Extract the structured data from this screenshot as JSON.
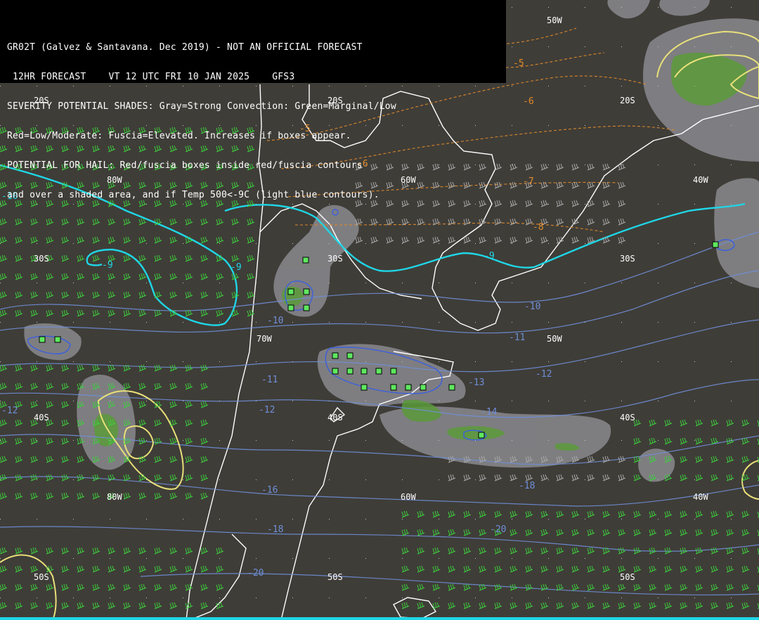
{
  "header": {
    "lines": [
      "GR02T (Galvez & Santavana. Dec 2019) - NOT AN OFFICIAL FORECAST",
      " 12HR FORECAST    VT 12 UTC FRI 10 JAN 2025    GFS3",
      "SEVERITY POTENTIAL SHADES: Gray=Strong Convection: Green=Marginal/Low",
      "Red=Low/Moderate: Fuscia=Elevated. Increases if boxes appear.",
      "POTENTIAL FOR HAIL: Red/fuscia boxes inside red/fuscia contours",
      "and over a shaded area, and if Temp 500<-9C (light blue contours)."
    ]
  },
  "colors": {
    "background": "#3f3d38",
    "land_outline": "#ffffff",
    "severity_gray": "#8a8a8e",
    "severity_green": "#5a9a3a",
    "temp_minus9": "#1fd6e6",
    "temp_contour": "#6f8fd8",
    "thickness_contour": "#d9862a",
    "jet_contour": "#e9e07a",
    "wind_barb_green": "#3ccf3c",
    "wind_barb_gray": "#a8a8a8",
    "hail_box": "#5fe85f"
  },
  "grid": {
    "lat_labels": [
      "20S",
      "30S",
      "40S",
      "50S"
    ],
    "lon_labels": [
      "80W",
      "70W",
      "60W",
      "50W",
      "40W"
    ]
  },
  "temp_labels": [
    "-9",
    "-9",
    "-9",
    "-10",
    "-10",
    "-11",
    "-11",
    "-12",
    "-12",
    "-13",
    "-14",
    "-16",
    "-18",
    "-18",
    "-20",
    "-20",
    "-12",
    "-10"
  ],
  "thickness_labels": [
    "-5",
    "-5",
    "-6",
    "-6",
    "-7",
    "-8"
  ]
}
